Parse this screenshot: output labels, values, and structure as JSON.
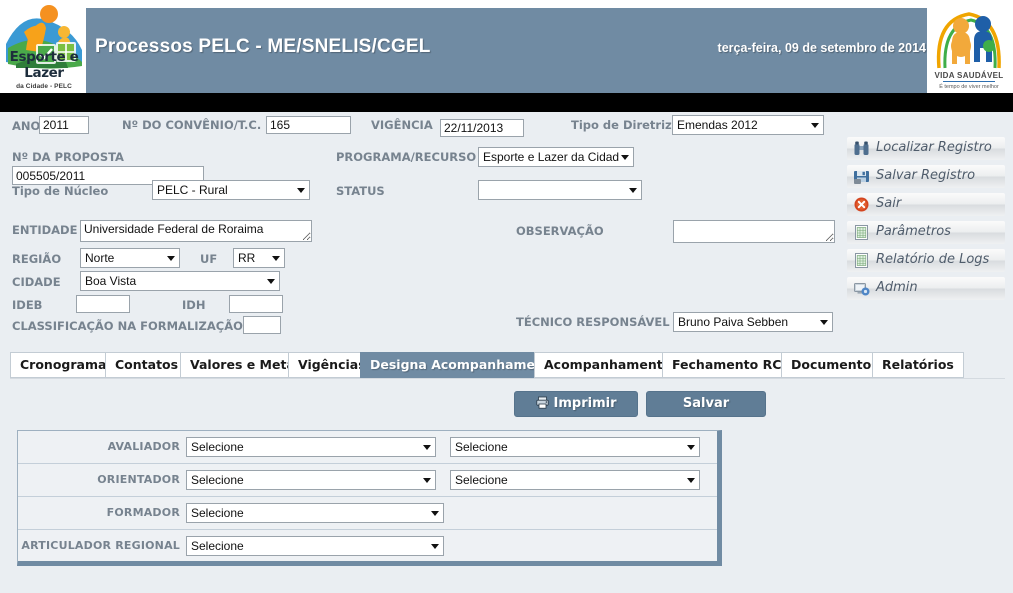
{
  "header": {
    "title": "Processos PELC - ME/SNELIS/CGEL",
    "date": "terça-feira, 09 de setembro de 2014",
    "logo_left_line1": "Esporte e Lazer",
    "logo_left_line2": "da Cidade - PELC",
    "logo_right_line1": "VIDA SAUDÁVEL",
    "logo_right_line2": "É tempo de viver melhor",
    "band_color": "#708ba3"
  },
  "form": {
    "ano_label": "ANO",
    "ano_value": "2011",
    "convenio_label": "Nº DO CONVÊNIO/T.C.",
    "convenio_value": "165",
    "vigencia_label": "VIGÊNCIA",
    "vigencia_value": "22/11/2013",
    "tipo_diretriz_label": "Tipo de Diretriz",
    "tipo_diretriz_value": "Emendas 2012",
    "proposta_label": "Nº DA PROPOSTA",
    "proposta_value": "005505/2011",
    "programa_label": "PROGRAMA/RECURSO",
    "programa_value": "Esporte e Lazer da Cidad",
    "tipo_nucleo_label": "Tipo de Núcleo",
    "tipo_nucleo_value": "PELC - Rural",
    "status_label": "STATUS",
    "status_value": "",
    "entidade_label": "ENTIDADE",
    "entidade_value": "Universidade Federal de Roraima",
    "observacao_label": "OBSERVAÇÃO",
    "observacao_value": "",
    "regiao_label": "REGIÃO",
    "regiao_value": "Norte",
    "uf_label": "UF",
    "uf_value": "RR",
    "cidade_label": "CIDADE",
    "cidade_value": "Boa Vista",
    "ideb_label": "IDEB",
    "ideb_value": "",
    "idh_label": "IDH",
    "idh_value": "",
    "classificacao_label": "CLASSIFICAÇÃO NA FORMALIZAÇÃO",
    "classificacao_value": "",
    "tecnico_label": "TÉCNICO RESPONSÁVEL",
    "tecnico_value": "Bruno Paiva Sebben"
  },
  "menu": {
    "items": [
      {
        "label": "Localizar Registro",
        "icon": "binoculars-icon"
      },
      {
        "label": "Salvar Registro",
        "icon": "save-disk-icon"
      },
      {
        "label": "Sair",
        "icon": "exit-error-icon"
      },
      {
        "label": "Parâmetros",
        "icon": "document-icon"
      },
      {
        "label": "Relatório de Logs",
        "icon": "document-icon"
      },
      {
        "label": "Admin",
        "icon": "admin-gear-icon"
      }
    ]
  },
  "tabs": {
    "items": [
      {
        "label": "Cronograma",
        "active": false
      },
      {
        "label": "Contatos",
        "active": false
      },
      {
        "label": "Valores e Metas",
        "active": false
      },
      {
        "label": "Vigências",
        "active": false
      },
      {
        "label": "Designa Acompanhamento",
        "active": true
      },
      {
        "label": "Acompanhamento",
        "active": false
      },
      {
        "label": "Fechamento RCO",
        "active": false
      },
      {
        "label": "Documentos",
        "active": false
      },
      {
        "label": "Relatórios",
        "active": false
      }
    ]
  },
  "actions": {
    "print_label": "Imprimir",
    "print_icon": "printer-icon",
    "save_label": "Salvar"
  },
  "designation": {
    "placeholder": "Selecione",
    "rows": [
      {
        "label": "AVALIADOR",
        "value_a": "Selecione",
        "value_b": "Selecione",
        "has_second": true
      },
      {
        "label": "ORIENTADOR",
        "value_a": "Selecione",
        "value_b": "Selecione",
        "has_second": true
      },
      {
        "label": "FORMADOR",
        "value_a": "Selecione",
        "value_b": "",
        "has_second": false
      },
      {
        "label": "ARTICULADOR REGIONAL",
        "value_a": "Selecione",
        "value_b": "",
        "has_second": false
      }
    ]
  }
}
